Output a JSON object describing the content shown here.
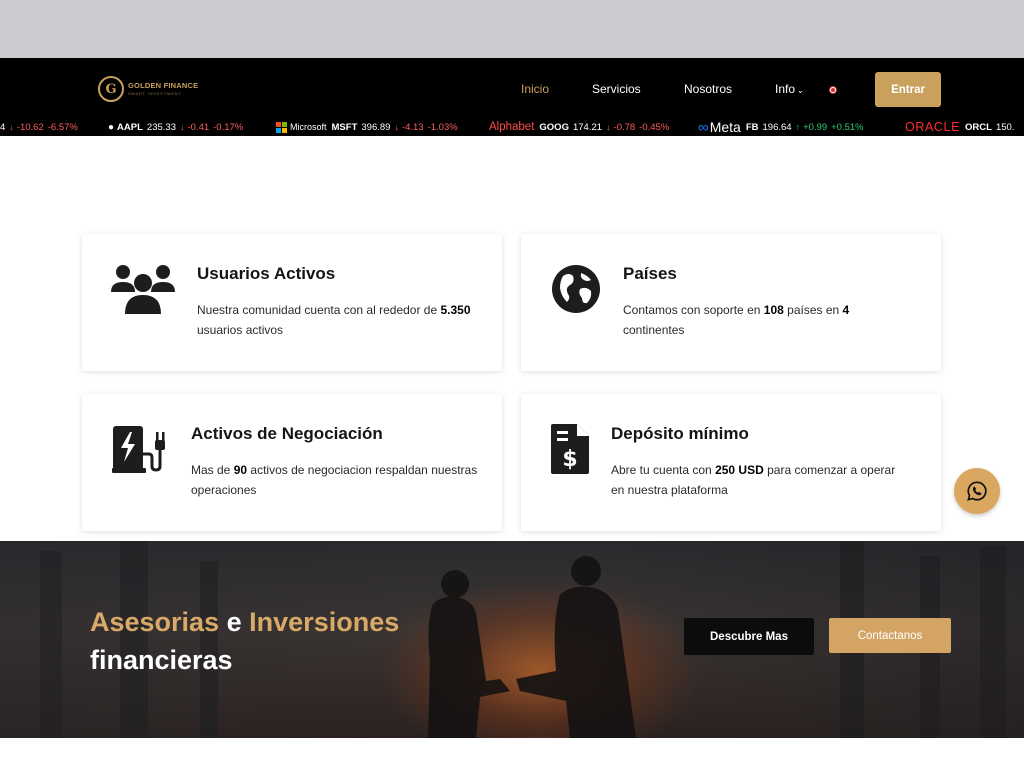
{
  "brand": {
    "name": "GOLDEN FINANCE",
    "tagline": "SMART INVESTMENT",
    "gold": "#c9a05c"
  },
  "nav": {
    "items": [
      {
        "label": "Inicio",
        "active": true
      },
      {
        "label": "Servicios"
      },
      {
        "label": "Nosotros"
      },
      {
        "label": "Info"
      }
    ],
    "cta": "Entrar"
  },
  "ticker": [
    {
      "symbol": "",
      "price": "",
      "change": "-10.62",
      "pct": "-6.57%",
      "dir": "down",
      "prefix": "4"
    },
    {
      "symbol": "AAPL",
      "price": "235.33",
      "change": "-0.41",
      "pct": "-0.17%",
      "dir": "down"
    },
    {
      "brand": "Microsoft",
      "symbol": "MSFT",
      "price": "396.89",
      "change": "-4.13",
      "pct": "-1.03%",
      "dir": "down"
    },
    {
      "brand": "Alphabet",
      "symbol": "GOOG",
      "price": "174.21",
      "change": "-0.78",
      "pct": "-0.45%",
      "dir": "down"
    },
    {
      "brand": "Meta",
      "symbol": "FB",
      "price": "196.64",
      "change": "+0.99",
      "pct": "+0.51%",
      "dir": "up"
    },
    {
      "brand": "ORACLE",
      "symbol": "ORCL",
      "price": "150.",
      "dir": "down"
    }
  ],
  "stats": {
    "users": {
      "title": "Usuarios Activos",
      "desc_pre": "Nuestra comunidad cuenta con al rededor de",
      "desc_bold": "5.350",
      "desc_post": "usuarios activos"
    },
    "countries": {
      "title": "Países",
      "desc_pre": "Contamos con soporte en",
      "desc_bold1": "108",
      "desc_mid": "países en",
      "desc_bold2": "4",
      "desc_post": "continentes"
    },
    "assets": {
      "title": "Activos de Negociación",
      "desc_pre": "Mas de",
      "desc_bold": "90",
      "desc_post": "activos de negociacion respaldan nuestras operaciones"
    },
    "deposit": {
      "title": "Depósito mínimo",
      "desc_pre": "Abre tu cuenta con",
      "desc_bold": "250 USD",
      "desc_post": "para comenzar a operar en nuestra plataforma"
    }
  },
  "banner": {
    "word1": "Asesorias",
    "word2": "e",
    "word3": "Inversiones",
    "word4": "financieras",
    "btn_more": "Descubre Mas",
    "btn_contact": "Contactanos"
  }
}
